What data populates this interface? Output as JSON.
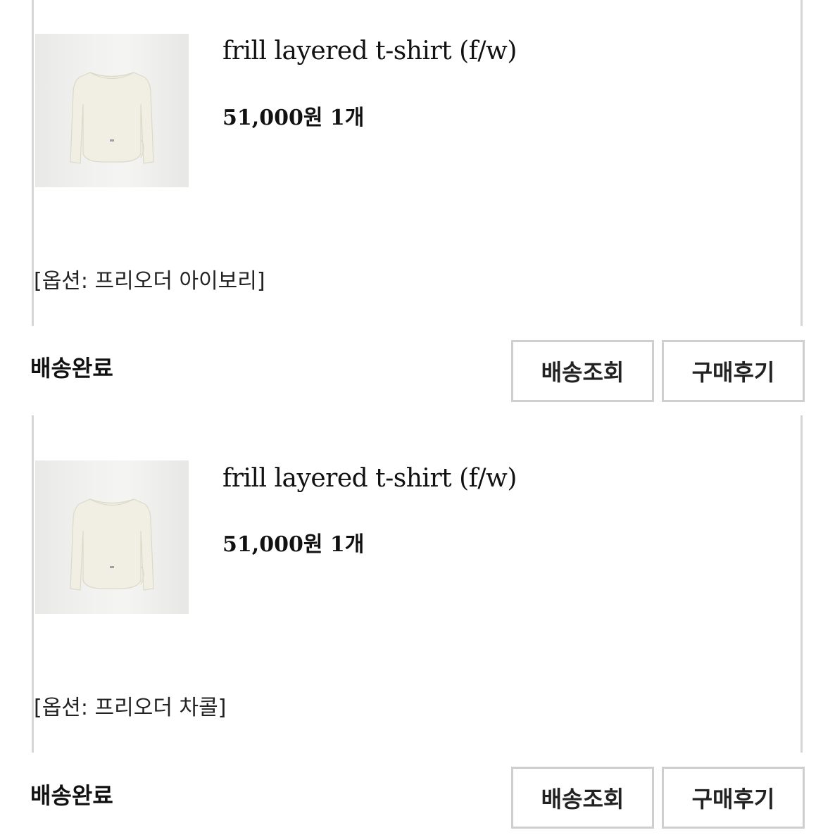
{
  "orders": [
    {
      "product_name": "frill layered t-shirt (f/w)",
      "price": "51,000원",
      "quantity": "1개",
      "option": "[옵션: 프리오더 아이보리]",
      "status": "배송완료",
      "track_label": "배송조회",
      "review_label": "구매후기",
      "thumbnail_icon": "cropped-long-sleeve-top-image",
      "thumbnail_color": "#f1efe3"
    },
    {
      "product_name": "frill layered t-shirt (f/w)",
      "price": "51,000원",
      "quantity": "1개",
      "option": "[옵션: 프리오더 차콜]",
      "status": "배송완료",
      "track_label": "배송조회",
      "review_label": "구매후기",
      "thumbnail_icon": "cropped-long-sleeve-top-image",
      "thumbnail_color": "#f1efe3"
    }
  ],
  "colors": {
    "card_border": "#d6d6d6",
    "button_border": "#cfcfcf",
    "text": "#111111"
  }
}
